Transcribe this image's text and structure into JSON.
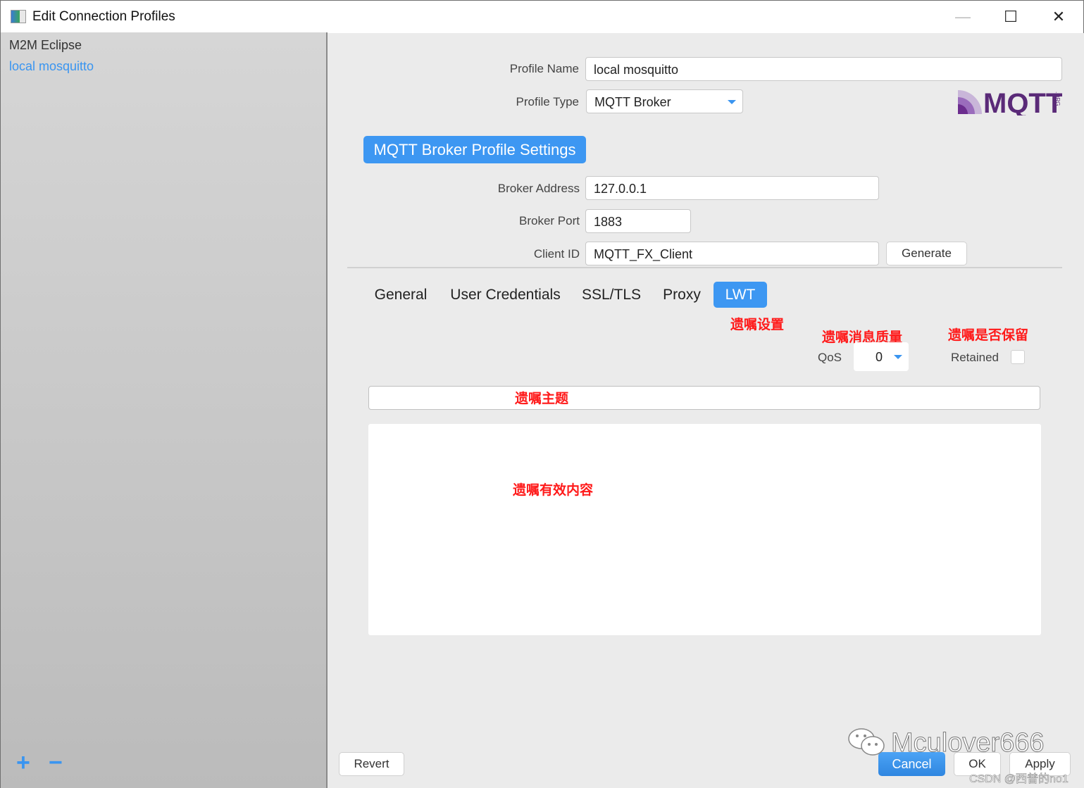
{
  "window": {
    "title": "Edit Connection Profiles",
    "minimize_label": "—",
    "maximize_label": "☐",
    "close_label": "✕"
  },
  "sidebar": {
    "items": [
      {
        "label": "M2M Eclipse",
        "selected": false
      },
      {
        "label": "local mosquitto",
        "selected": true
      }
    ],
    "add_label": "+",
    "remove_label": "−"
  },
  "profile": {
    "name_label": "Profile Name",
    "name_value": "local mosquitto",
    "type_label": "Profile Type",
    "type_value": "MQTT Broker",
    "logo_text": "MQTT",
    "logo_suffix": ".ORG"
  },
  "broker": {
    "section_title": "MQTT Broker Profile Settings",
    "address_label": "Broker Address",
    "address_value": "127.0.0.1",
    "port_label": "Broker Port",
    "port_value": "1883",
    "client_id_label": "Client ID",
    "client_id_value": "MQTT_FX_Client",
    "generate_label": "Generate"
  },
  "tabs": [
    {
      "label": "General",
      "active": false
    },
    {
      "label": "User Credentials",
      "active": false
    },
    {
      "label": "SSL/TLS",
      "active": false
    },
    {
      "label": "Proxy",
      "active": false
    },
    {
      "label": "LWT",
      "active": true
    }
  ],
  "lwt": {
    "qos_label": "QoS",
    "qos_value": "0",
    "retained_label": "Retained",
    "retained_checked": false,
    "topic_value": "",
    "payload_value": ""
  },
  "annotations": {
    "lwt_settings": "遗嘱设置",
    "qos": "遗嘱消息质量",
    "retained": "遗嘱是否保留",
    "topic": "遗嘱主题",
    "payload": "遗嘱有效内容"
  },
  "footer": {
    "revert_label": "Revert",
    "cancel_label": "Cancel",
    "ok_label": "OK",
    "apply_label": "Apply"
  },
  "watermarks": {
    "wechat": "Mculover666",
    "csdn": "CSDN @西普的no1"
  },
  "colors": {
    "accent": "#3d97f2",
    "annotation": "#ff1a1a",
    "logo": "#5a2a78"
  }
}
